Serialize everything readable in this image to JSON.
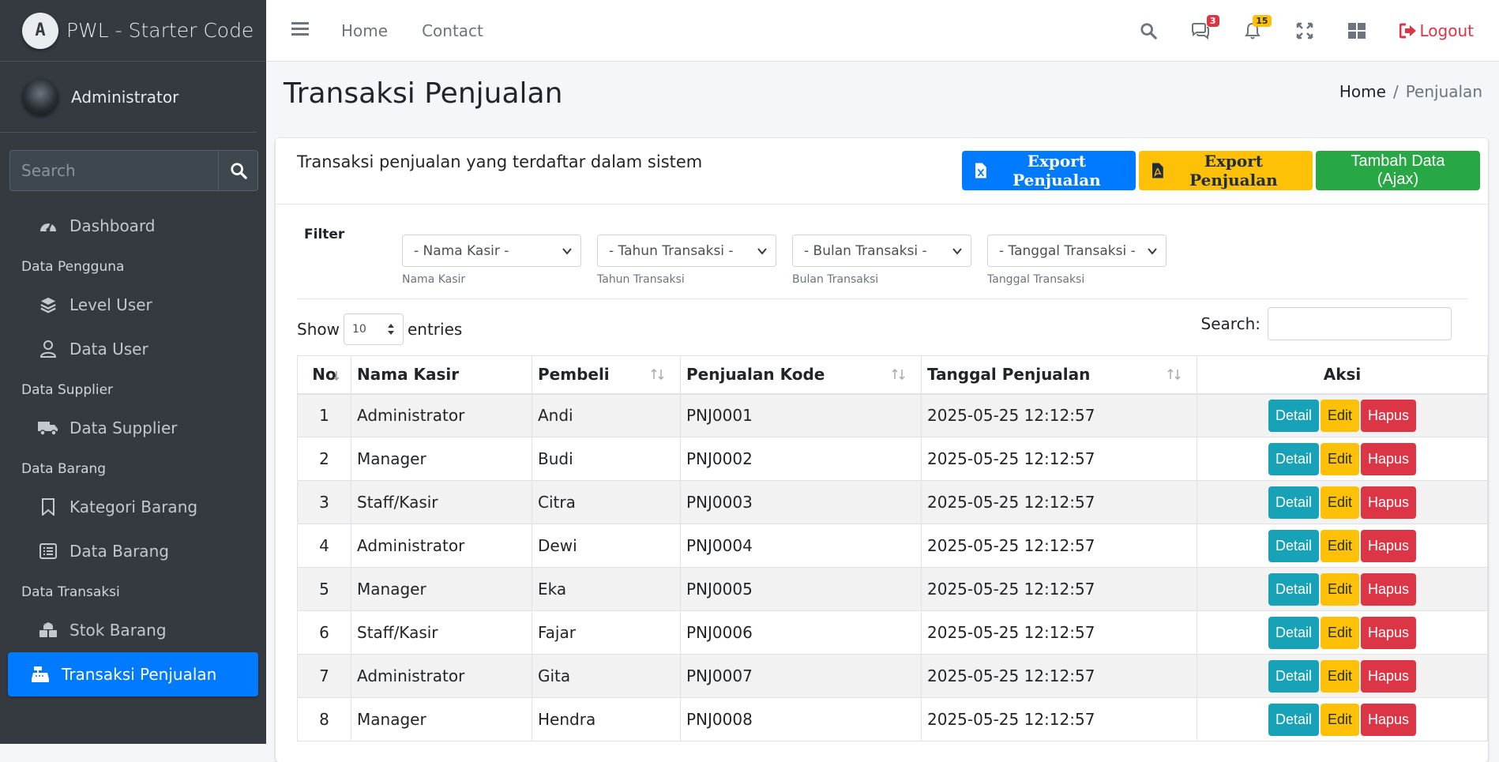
{
  "brand": {
    "text": "PWL - Starter Code"
  },
  "user": {
    "name": "Administrator"
  },
  "sidebar_search": {
    "placeholder": "Search"
  },
  "nav": {
    "dashboard": "Dashboard",
    "header_pengguna": "Data Pengguna",
    "level_user": "Level User",
    "data_user": "Data User",
    "header_supplier": "Data Supplier",
    "data_supplier": "Data Supplier",
    "header_barang": "Data Barang",
    "kategori_barang": "Kategori Barang",
    "data_barang": "Data Barang",
    "header_transaksi": "Data Transaksi",
    "stok_barang": "Stok Barang",
    "transaksi_penjualan": "Transaksi Penjualan"
  },
  "topbar": {
    "home": "Home",
    "contact": "Contact",
    "messages_badge": "3",
    "notifications_badge": "15",
    "logout": "Logout"
  },
  "page": {
    "title": "Transaksi Penjualan",
    "breadcrumb_home": "Home",
    "breadcrumb_sep": "/",
    "breadcrumb_current": "Penjualan"
  },
  "card": {
    "title": "Transaksi penjualan yang terdaftar dalam sistem",
    "export_excel": "Export Penjualan",
    "export_pdf": "Export Penjualan",
    "add_ajax": "Tambah Data (Ajax)"
  },
  "filter": {
    "label": "Filter",
    "kasir_value": "- Nama Kasir -",
    "kasir_label": "Nama Kasir",
    "tahun_value": "- Tahun Transaksi -",
    "tahun_label": "Tahun Transaksi",
    "bulan_value": "- Bulan Transaksi -",
    "bulan_label": "Bulan Transaksi",
    "tanggal_value": "- Tanggal Transaksi -",
    "tanggal_label": "Tanggal Transaksi"
  },
  "datatable": {
    "show": "Show",
    "length": "10",
    "entries": "entries",
    "search_label": "Search:"
  },
  "table": {
    "headers": [
      "No",
      "Nama Kasir",
      "Pembeli",
      "Penjualan Kode",
      "Tanggal Penjualan",
      "Aksi"
    ],
    "actions": {
      "detail": "Detail",
      "edit": "Edit",
      "hapus": "Hapus"
    },
    "rows": [
      [
        "1",
        "Administrator",
        "Andi",
        "PNJ0001",
        "2025-05-25 12:12:57"
      ],
      [
        "2",
        "Manager",
        "Budi",
        "PNJ0002",
        "2025-05-25 12:12:57"
      ],
      [
        "3",
        "Staff/Kasir",
        "Citra",
        "PNJ0003",
        "2025-05-25 12:12:57"
      ],
      [
        "4",
        "Administrator",
        "Dewi",
        "PNJ0004",
        "2025-05-25 12:12:57"
      ],
      [
        "5",
        "Manager",
        "Eka",
        "PNJ0005",
        "2025-05-25 12:12:57"
      ],
      [
        "6",
        "Staff/Kasir",
        "Fajar",
        "PNJ0006",
        "2025-05-25 12:12:57"
      ],
      [
        "7",
        "Administrator",
        "Gita",
        "PNJ0007",
        "2025-05-25 12:12:57"
      ],
      [
        "8",
        "Manager",
        "Hendra",
        "PNJ0008",
        "2025-05-25 12:12:57"
      ]
    ]
  }
}
